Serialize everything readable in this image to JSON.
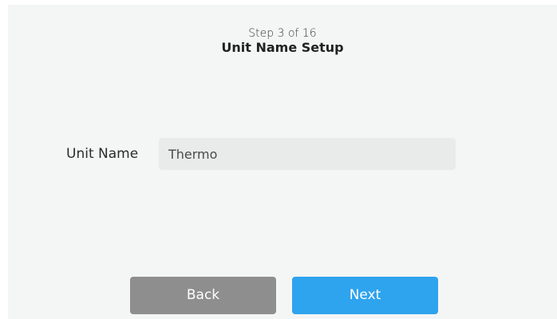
{
  "header": {
    "step": "Step 3 of 16",
    "title": "Unit Name Setup"
  },
  "form": {
    "unit_name": {
      "label": "Unit Name",
      "value": "Thermo"
    }
  },
  "actions": {
    "back_label": "Back",
    "next_label": "Next"
  },
  "colors": {
    "background": "#f4f5f5",
    "input_background": "#e9ebea",
    "back_button": "#8e8e8e",
    "next_button": "#2ea3ee"
  }
}
